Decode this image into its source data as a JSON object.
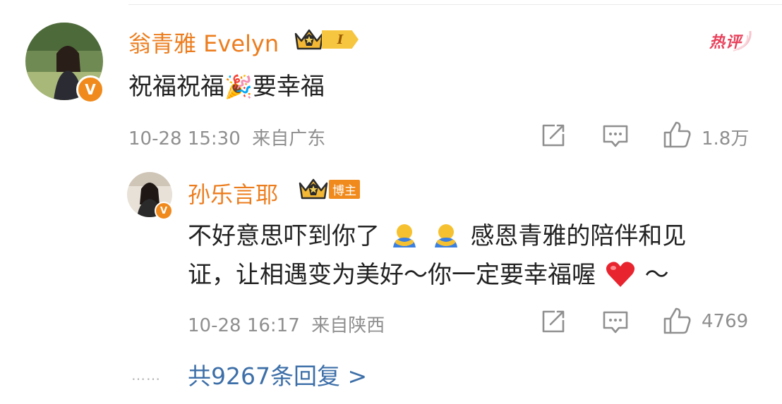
{
  "comment": {
    "author": "翁青雅 Evelyn",
    "level": "I",
    "hot_label": "热评",
    "text": "祝福祝福",
    "emoji_party": "🎉",
    "text_tail": "要幸福",
    "date": "10-28 15:30",
    "location": "来自广东",
    "like_count": "1.8万"
  },
  "reply": {
    "author": "孙乐言耶",
    "blogger_label": "博主",
    "line1": "不好意思吓到你了",
    "line1_tail": "感恩青雅的陪伴和见",
    "line2": "证，让相遇变为美好～你一定要幸福喔",
    "line2_tail": "～",
    "date": "10-28 16:17",
    "location": "来自陕西",
    "like_count": "4769"
  },
  "footer": {
    "dots": "……",
    "more_replies": "共9267条回复 >"
  },
  "colors": {
    "name": "#ec7d1e",
    "link": "#3d6fa8",
    "meta": "#8f8f8f",
    "hot": "#e8425c",
    "badge": "#f08a1c"
  },
  "icons": [
    "share-icon",
    "comment-icon",
    "like-icon",
    "crown-icon",
    "verified-icon"
  ]
}
